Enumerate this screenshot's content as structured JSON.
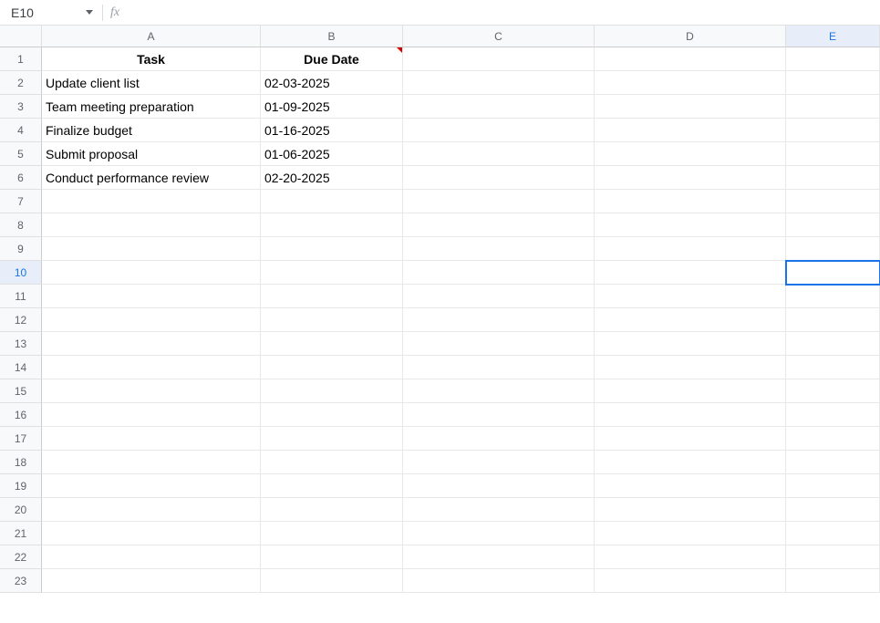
{
  "nameBox": {
    "value": "E10"
  },
  "formulaBar": {
    "fxLabel": "fx",
    "value": ""
  },
  "columns": [
    {
      "id": "A",
      "label": "A",
      "selected": false
    },
    {
      "id": "B",
      "label": "B",
      "selected": false
    },
    {
      "id": "C",
      "label": "C",
      "selected": false
    },
    {
      "id": "D",
      "label": "D",
      "selected": false
    },
    {
      "id": "E",
      "label": "E",
      "selected": true
    }
  ],
  "rows": [
    {
      "num": "1",
      "selected": false
    },
    {
      "num": "2",
      "selected": false
    },
    {
      "num": "3",
      "selected": false
    },
    {
      "num": "4",
      "selected": false
    },
    {
      "num": "5",
      "selected": false
    },
    {
      "num": "6",
      "selected": false
    },
    {
      "num": "7",
      "selected": false
    },
    {
      "num": "8",
      "selected": false
    },
    {
      "num": "9",
      "selected": false
    },
    {
      "num": "10",
      "selected": true
    },
    {
      "num": "11",
      "selected": false
    },
    {
      "num": "12",
      "selected": false
    },
    {
      "num": "13",
      "selected": false
    },
    {
      "num": "14",
      "selected": false
    },
    {
      "num": "15",
      "selected": false
    },
    {
      "num": "16",
      "selected": false
    },
    {
      "num": "17",
      "selected": false
    },
    {
      "num": "18",
      "selected": false
    },
    {
      "num": "19",
      "selected": false
    },
    {
      "num": "20",
      "selected": false
    },
    {
      "num": "21",
      "selected": false
    },
    {
      "num": "22",
      "selected": false
    },
    {
      "num": "23",
      "selected": false
    }
  ],
  "activeCell": {
    "row": 10,
    "col": "E"
  },
  "cellsWithNote": [
    "B1"
  ],
  "sheet": {
    "headers": {
      "A": "Task",
      "B": "Due Date"
    },
    "data": [
      {
        "A": "Update client list",
        "B": "02-03-2025"
      },
      {
        "A": "Team meeting preparation",
        "B": "01-09-2025"
      },
      {
        "A": "Finalize budget",
        "B": "01-16-2025"
      },
      {
        "A": "Submit proposal",
        "B": "01-06-2025"
      },
      {
        "A": "Conduct performance review",
        "B": "02-20-2025"
      }
    ]
  }
}
